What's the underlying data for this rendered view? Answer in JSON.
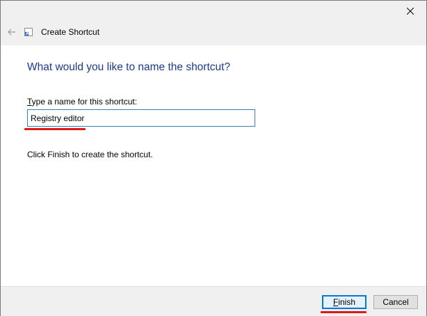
{
  "window": {
    "title": "Create Shortcut",
    "close_icon": "close-icon",
    "back_icon": "back-arrow-icon",
    "wizard_icon": "shortcut-icon"
  },
  "page": {
    "heading": "What would you like to name the shortcut?",
    "field_label_first": "T",
    "field_label_rest": "ype a name for this shortcut:",
    "name_value": "Registry editor",
    "hint": "Click Finish to create the shortcut."
  },
  "footer": {
    "finish_first": "F",
    "finish_rest": "inish",
    "cancel_label": "Cancel"
  },
  "colors": {
    "heading": "#1c3a8a",
    "accent": "#0078d7",
    "annotation": "#e01818",
    "chrome": "#f0f0f0"
  }
}
